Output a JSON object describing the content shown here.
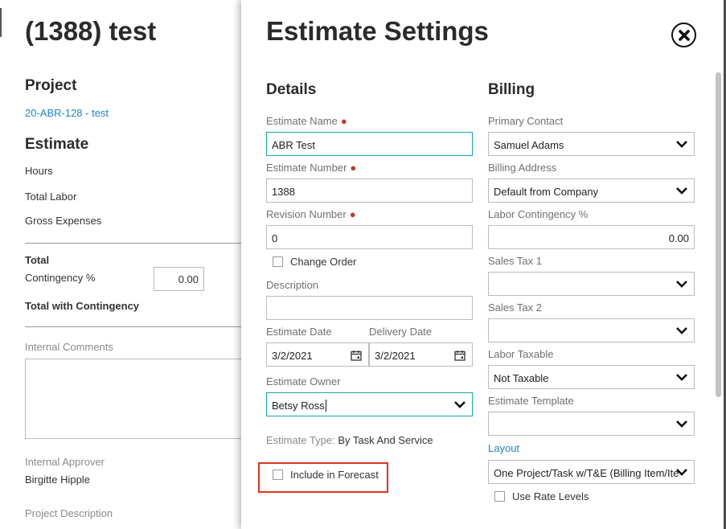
{
  "background": {
    "title": "(1388) test",
    "project_heading": "Project",
    "project_link": "20-ABR-128 - test",
    "estimate_heading": "Estimate",
    "hours_label": "Hours",
    "total_labor_label": "Total Labor",
    "gross_expenses_label": "Gross Expenses",
    "total_label": "Total",
    "contingency_label": "Contingency %",
    "contingency_value": "0.00",
    "total_with_contingency_label": "Total with Contingency",
    "internal_comments_label": "Internal Comments",
    "internal_approver_label": "Internal Approver",
    "internal_approver_value": "Birgitte Hipple",
    "project_description_label": "Project Description"
  },
  "modal": {
    "title": "Estimate Settings",
    "close_icon": "close-circle-icon",
    "details": {
      "heading": "Details",
      "estimate_name_label": "Estimate Name",
      "estimate_name_value": "ABR Test",
      "estimate_number_label": "Estimate Number",
      "estimate_number_value": "1388",
      "revision_number_label": "Revision Number",
      "revision_number_value": "0",
      "change_order_label": "Change Order",
      "description_label": "Description",
      "description_value": "",
      "estimate_date_label": "Estimate Date",
      "estimate_date_value": "3/2/2021",
      "delivery_date_label": "Delivery Date",
      "delivery_date_value": "3/2/2021",
      "estimate_owner_label": "Estimate Owner",
      "estimate_owner_value": "Betsy Ross",
      "estimate_type_key": "Estimate Type:",
      "estimate_type_value": "By Task And Service",
      "include_forecast_label": "Include in Forecast"
    },
    "billing": {
      "heading": "Billing",
      "primary_contact_label": "Primary Contact",
      "primary_contact_value": "Samuel Adams",
      "billing_address_label": "Billing Address",
      "billing_address_value": "Default from Company",
      "labor_contingency_label": "Labor Contingency %",
      "labor_contingency_value": "0.00",
      "sales_tax1_label": "Sales Tax 1",
      "sales_tax1_value": "",
      "sales_tax2_label": "Sales Tax 2",
      "sales_tax2_value": "",
      "labor_taxable_label": "Labor Taxable",
      "labor_taxable_value": "Not Taxable",
      "estimate_template_label": "Estimate Template",
      "estimate_template_value": "",
      "layout_label": "Layout",
      "layout_value": "One Project/Task w/T&E (Billing Item/Ite",
      "use_rate_levels_label": "Use Rate Levels"
    },
    "colors": {
      "required_dot": "#c0392b",
      "focus_border": "#1aa6a6",
      "link_blue": "#1f86c2",
      "highlight_red": "#e0321e"
    }
  }
}
